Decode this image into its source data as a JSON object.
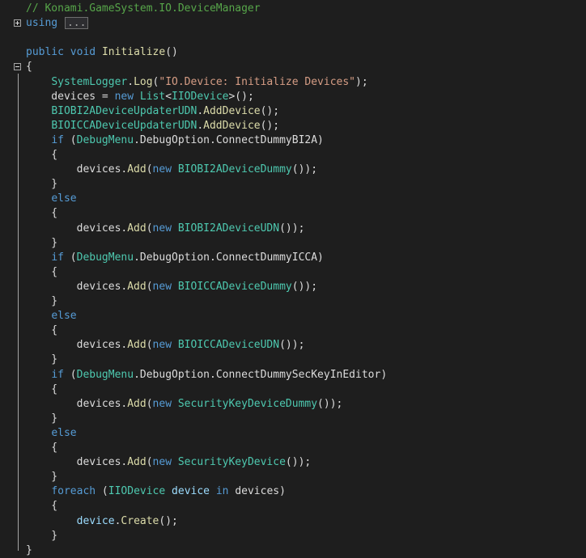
{
  "editor": {
    "collapsed_block": "...",
    "lines": [
      [
        {
          "t": "// Konami.GameSystem.IO.DeviceManager",
          "c": "cm"
        }
      ],
      [
        {
          "t": "using",
          "c": "kw"
        },
        {
          "t": " "
        },
        {
          "t": "...",
          "c": "collapsed"
        }
      ],
      [],
      [
        {
          "t": "public",
          "c": "kw"
        },
        {
          "t": " "
        },
        {
          "t": "void",
          "c": "kw"
        },
        {
          "t": " "
        },
        {
          "t": "Initialize",
          "c": "fn"
        },
        {
          "t": "()"
        }
      ],
      [
        {
          "t": "{"
        }
      ],
      [
        {
          "t": "    "
        },
        {
          "t": "SystemLogger",
          "c": "ty"
        },
        {
          "t": "."
        },
        {
          "t": "Log",
          "c": "fn"
        },
        {
          "t": "("
        },
        {
          "t": "\"IO.Device: Initialize Devices\"",
          "c": "str"
        },
        {
          "t": ");"
        }
      ],
      [
        {
          "t": "    devices = "
        },
        {
          "t": "new",
          "c": "kw"
        },
        {
          "t": " "
        },
        {
          "t": "List",
          "c": "ty"
        },
        {
          "t": "<"
        },
        {
          "t": "IIODevice",
          "c": "ty"
        },
        {
          "t": ">();"
        }
      ],
      [
        {
          "t": "    "
        },
        {
          "t": "BIOBI2ADeviceUpdaterUDN",
          "c": "ty"
        },
        {
          "t": "."
        },
        {
          "t": "AddDevice",
          "c": "fn"
        },
        {
          "t": "();"
        }
      ],
      [
        {
          "t": "    "
        },
        {
          "t": "BIOICCADeviceUpdaterUDN",
          "c": "ty"
        },
        {
          "t": "."
        },
        {
          "t": "AddDevice",
          "c": "fn"
        },
        {
          "t": "();"
        }
      ],
      [
        {
          "t": "    "
        },
        {
          "t": "if",
          "c": "kw"
        },
        {
          "t": " ("
        },
        {
          "t": "DebugMenu",
          "c": "ty"
        },
        {
          "t": ".DebugOption.ConnectDummyBI2A)"
        }
      ],
      [
        {
          "t": "    {"
        }
      ],
      [
        {
          "t": "        devices."
        },
        {
          "t": "Add",
          "c": "fn"
        },
        {
          "t": "("
        },
        {
          "t": "new",
          "c": "kw"
        },
        {
          "t": " "
        },
        {
          "t": "BIOBI2ADeviceDummy",
          "c": "ty"
        },
        {
          "t": "());"
        }
      ],
      [
        {
          "t": "    }"
        }
      ],
      [
        {
          "t": "    "
        },
        {
          "t": "else",
          "c": "kw"
        }
      ],
      [
        {
          "t": "    {"
        }
      ],
      [
        {
          "t": "        devices."
        },
        {
          "t": "Add",
          "c": "fn"
        },
        {
          "t": "("
        },
        {
          "t": "new",
          "c": "kw"
        },
        {
          "t": " "
        },
        {
          "t": "BIOBI2ADeviceUDN",
          "c": "ty"
        },
        {
          "t": "());"
        }
      ],
      [
        {
          "t": "    }"
        }
      ],
      [
        {
          "t": "    "
        },
        {
          "t": "if",
          "c": "kw"
        },
        {
          "t": " ("
        },
        {
          "t": "DebugMenu",
          "c": "ty"
        },
        {
          "t": ".DebugOption.ConnectDummyICCA)"
        }
      ],
      [
        {
          "t": "    {"
        }
      ],
      [
        {
          "t": "        devices."
        },
        {
          "t": "Add",
          "c": "fn"
        },
        {
          "t": "("
        },
        {
          "t": "new",
          "c": "kw"
        },
        {
          "t": " "
        },
        {
          "t": "BIOICCADeviceDummy",
          "c": "ty"
        },
        {
          "t": "());"
        }
      ],
      [
        {
          "t": "    }"
        }
      ],
      [
        {
          "t": "    "
        },
        {
          "t": "else",
          "c": "kw"
        }
      ],
      [
        {
          "t": "    {"
        }
      ],
      [
        {
          "t": "        devices."
        },
        {
          "t": "Add",
          "c": "fn"
        },
        {
          "t": "("
        },
        {
          "t": "new",
          "c": "kw"
        },
        {
          "t": " "
        },
        {
          "t": "BIOICCADeviceUDN",
          "c": "ty"
        },
        {
          "t": "());"
        }
      ],
      [
        {
          "t": "    }"
        }
      ],
      [
        {
          "t": "    "
        },
        {
          "t": "if",
          "c": "kw"
        },
        {
          "t": " ("
        },
        {
          "t": "DebugMenu",
          "c": "ty"
        },
        {
          "t": ".DebugOption.ConnectDummySecKeyInEditor)"
        }
      ],
      [
        {
          "t": "    {"
        }
      ],
      [
        {
          "t": "        devices."
        },
        {
          "t": "Add",
          "c": "fn"
        },
        {
          "t": "("
        },
        {
          "t": "new",
          "c": "kw"
        },
        {
          "t": " "
        },
        {
          "t": "SecurityKeyDeviceDummy",
          "c": "ty"
        },
        {
          "t": "());"
        }
      ],
      [
        {
          "t": "    }"
        }
      ],
      [
        {
          "t": "    "
        },
        {
          "t": "else",
          "c": "kw"
        }
      ],
      [
        {
          "t": "    {"
        }
      ],
      [
        {
          "t": "        devices."
        },
        {
          "t": "Add",
          "c": "fn"
        },
        {
          "t": "("
        },
        {
          "t": "new",
          "c": "kw"
        },
        {
          "t": " "
        },
        {
          "t": "SecurityKeyDevice",
          "c": "ty"
        },
        {
          "t": "());"
        }
      ],
      [
        {
          "t": "    }"
        }
      ],
      [
        {
          "t": "    "
        },
        {
          "t": "foreach",
          "c": "kw"
        },
        {
          "t": " ("
        },
        {
          "t": "IIODevice",
          "c": "ty"
        },
        {
          "t": " "
        },
        {
          "t": "device",
          "c": "var"
        },
        {
          "t": " "
        },
        {
          "t": "in",
          "c": "kw"
        },
        {
          "t": " devices)"
        }
      ],
      [
        {
          "t": "    {"
        }
      ],
      [
        {
          "t": "        "
        },
        {
          "t": "device",
          "c": "var"
        },
        {
          "t": "."
        },
        {
          "t": "Create",
          "c": "fn"
        },
        {
          "t": "();"
        }
      ],
      [
        {
          "t": "    }"
        }
      ],
      [
        {
          "t": "}"
        }
      ]
    ]
  },
  "colors": {
    "background": "#1e1e1e",
    "keyword": "#569cd6",
    "type": "#4ec9b0",
    "method": "#dcdcaa",
    "string": "#d69d85",
    "comment": "#57a64a",
    "plain": "#dcdcdc"
  }
}
